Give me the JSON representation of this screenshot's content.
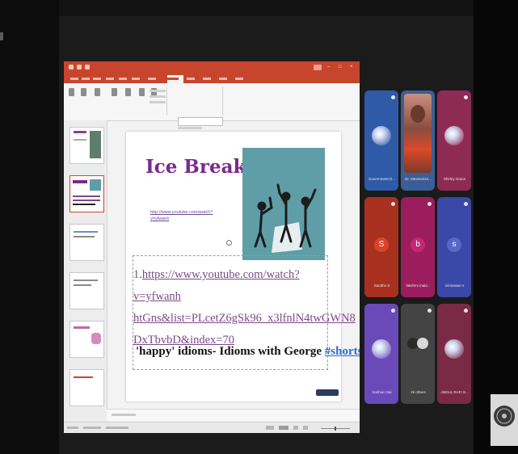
{
  "window": {
    "title": ""
  },
  "ppt": {
    "title": "",
    "menu": [
      "",
      "",
      "",
      "",
      "",
      "",
      "",
      "",
      "",
      "",
      "",
      ""
    ],
    "slide": {
      "title": "Ice Breaker",
      "small_link": "http://www.youtube.com/watch?v=yfwanh",
      "link_lines": [
        "https://www.youtube.com/watch?v=yfwanh",
        "htGns&list=PLcetZ6gSk96_x3lfnlN4twGWN8",
        "DxTbvbD&index=70"
      ],
      "link_prefix": "1.",
      "caption_main": "'happy' idioms- Idioms with George ",
      "caption_tag": "#shorts"
    },
    "thumbnails": [
      "1",
      "2",
      "3",
      "4",
      "5",
      "6"
    ]
  },
  "participants": [
    {
      "name": "Government D...",
      "bg": "#2e5aa8",
      "avatar": "image"
    },
    {
      "name": "Dr. Mesmerize...",
      "bg": "#3b5e96",
      "avatar": "photo"
    },
    {
      "name": "Shirley Grace",
      "bg": "#8e2b55",
      "avatar": "image"
    },
    {
      "name": "Sandhu S",
      "bg": "#a8301f",
      "avatar": "letter",
      "letter": "S",
      "letter_bg": "#d9432a"
    },
    {
      "name": "lakshmi mala...",
      "bg": "#9b1d5d",
      "avatar": "letter",
      "letter": "b",
      "letter_bg": "#c42874"
    },
    {
      "name": "srinivasan s",
      "bg": "#3a48a8",
      "avatar": "letter",
      "letter": "s",
      "letter_bg": "#5866c6"
    },
    {
      "name": "Soshoin Sai",
      "bg": "#6a4ab8",
      "avatar": "image"
    },
    {
      "name": "2k others",
      "bg": "#444444",
      "avatar": "group"
    },
    {
      "name": "ABDUL RAFI S...",
      "bg": "#7a2a45",
      "avatar": "image"
    }
  ],
  "colors": {
    "ppt_accent": "#c8452d",
    "slide_title": "#7a2a8c",
    "link": "#7a4a88",
    "hashtag": "#2b68c9"
  }
}
